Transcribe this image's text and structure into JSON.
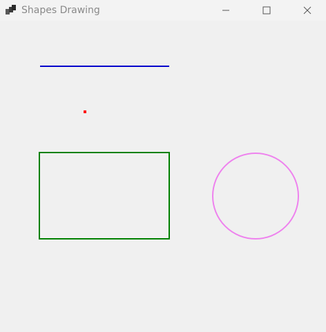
{
  "window": {
    "title": "Shapes Drawing",
    "icon": "app-window-icon",
    "controls": {
      "minimize_icon": "minimize-icon",
      "maximize_icon": "maximize-icon",
      "close_icon": "close-icon"
    }
  },
  "canvas": {
    "background": "#f0f0f0",
    "shapes": {
      "line": {
        "type": "line",
        "color": "#0000cc"
      },
      "point": {
        "type": "point",
        "color": "#ff0000"
      },
      "rectangle": {
        "type": "rectangle",
        "color": "#008000"
      },
      "circle": {
        "type": "circle",
        "color": "#ee82ee"
      }
    }
  }
}
